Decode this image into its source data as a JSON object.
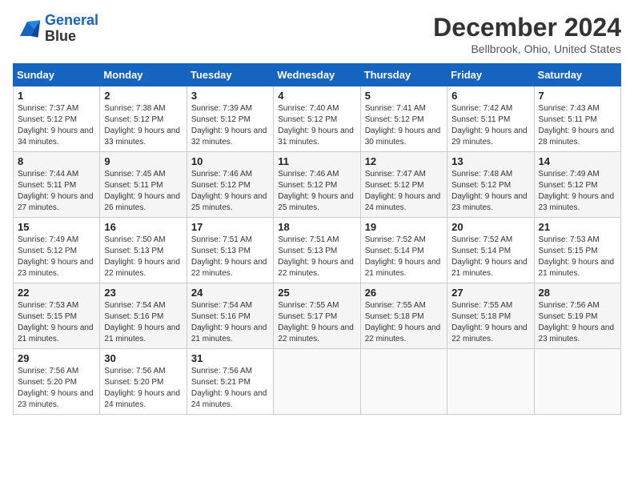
{
  "header": {
    "logo_line1": "General",
    "logo_line2": "Blue",
    "month_title": "December 2024",
    "location": "Bellbrook, Ohio, United States"
  },
  "days_of_week": [
    "Sunday",
    "Monday",
    "Tuesday",
    "Wednesday",
    "Thursday",
    "Friday",
    "Saturday"
  ],
  "weeks": [
    [
      {
        "day": "1",
        "sunrise": "Sunrise: 7:37 AM",
        "sunset": "Sunset: 5:12 PM",
        "daylight": "Daylight: 9 hours and 34 minutes."
      },
      {
        "day": "2",
        "sunrise": "Sunrise: 7:38 AM",
        "sunset": "Sunset: 5:12 PM",
        "daylight": "Daylight: 9 hours and 33 minutes."
      },
      {
        "day": "3",
        "sunrise": "Sunrise: 7:39 AM",
        "sunset": "Sunset: 5:12 PM",
        "daylight": "Daylight: 9 hours and 32 minutes."
      },
      {
        "day": "4",
        "sunrise": "Sunrise: 7:40 AM",
        "sunset": "Sunset: 5:12 PM",
        "daylight": "Daylight: 9 hours and 31 minutes."
      },
      {
        "day": "5",
        "sunrise": "Sunrise: 7:41 AM",
        "sunset": "Sunset: 5:12 PM",
        "daylight": "Daylight: 9 hours and 30 minutes."
      },
      {
        "day": "6",
        "sunrise": "Sunrise: 7:42 AM",
        "sunset": "Sunset: 5:11 PM",
        "daylight": "Daylight: 9 hours and 29 minutes."
      },
      {
        "day": "7",
        "sunrise": "Sunrise: 7:43 AM",
        "sunset": "Sunset: 5:11 PM",
        "daylight": "Daylight: 9 hours and 28 minutes."
      }
    ],
    [
      {
        "day": "8",
        "sunrise": "Sunrise: 7:44 AM",
        "sunset": "Sunset: 5:11 PM",
        "daylight": "Daylight: 9 hours and 27 minutes."
      },
      {
        "day": "9",
        "sunrise": "Sunrise: 7:45 AM",
        "sunset": "Sunset: 5:11 PM",
        "daylight": "Daylight: 9 hours and 26 minutes."
      },
      {
        "day": "10",
        "sunrise": "Sunrise: 7:46 AM",
        "sunset": "Sunset: 5:12 PM",
        "daylight": "Daylight: 9 hours and 25 minutes."
      },
      {
        "day": "11",
        "sunrise": "Sunrise: 7:46 AM",
        "sunset": "Sunset: 5:12 PM",
        "daylight": "Daylight: 9 hours and 25 minutes."
      },
      {
        "day": "12",
        "sunrise": "Sunrise: 7:47 AM",
        "sunset": "Sunset: 5:12 PM",
        "daylight": "Daylight: 9 hours and 24 minutes."
      },
      {
        "day": "13",
        "sunrise": "Sunrise: 7:48 AM",
        "sunset": "Sunset: 5:12 PM",
        "daylight": "Daylight: 9 hours and 23 minutes."
      },
      {
        "day": "14",
        "sunrise": "Sunrise: 7:49 AM",
        "sunset": "Sunset: 5:12 PM",
        "daylight": "Daylight: 9 hours and 23 minutes."
      }
    ],
    [
      {
        "day": "15",
        "sunrise": "Sunrise: 7:49 AM",
        "sunset": "Sunset: 5:12 PM",
        "daylight": "Daylight: 9 hours and 23 minutes."
      },
      {
        "day": "16",
        "sunrise": "Sunrise: 7:50 AM",
        "sunset": "Sunset: 5:13 PM",
        "daylight": "Daylight: 9 hours and 22 minutes."
      },
      {
        "day": "17",
        "sunrise": "Sunrise: 7:51 AM",
        "sunset": "Sunset: 5:13 PM",
        "daylight": "Daylight: 9 hours and 22 minutes."
      },
      {
        "day": "18",
        "sunrise": "Sunrise: 7:51 AM",
        "sunset": "Sunset: 5:13 PM",
        "daylight": "Daylight: 9 hours and 22 minutes."
      },
      {
        "day": "19",
        "sunrise": "Sunrise: 7:52 AM",
        "sunset": "Sunset: 5:14 PM",
        "daylight": "Daylight: 9 hours and 21 minutes."
      },
      {
        "day": "20",
        "sunrise": "Sunrise: 7:52 AM",
        "sunset": "Sunset: 5:14 PM",
        "daylight": "Daylight: 9 hours and 21 minutes."
      },
      {
        "day": "21",
        "sunrise": "Sunrise: 7:53 AM",
        "sunset": "Sunset: 5:15 PM",
        "daylight": "Daylight: 9 hours and 21 minutes."
      }
    ],
    [
      {
        "day": "22",
        "sunrise": "Sunrise: 7:53 AM",
        "sunset": "Sunset: 5:15 PM",
        "daylight": "Daylight: 9 hours and 21 minutes."
      },
      {
        "day": "23",
        "sunrise": "Sunrise: 7:54 AM",
        "sunset": "Sunset: 5:16 PM",
        "daylight": "Daylight: 9 hours and 21 minutes."
      },
      {
        "day": "24",
        "sunrise": "Sunrise: 7:54 AM",
        "sunset": "Sunset: 5:16 PM",
        "daylight": "Daylight: 9 hours and 21 minutes."
      },
      {
        "day": "25",
        "sunrise": "Sunrise: 7:55 AM",
        "sunset": "Sunset: 5:17 PM",
        "daylight": "Daylight: 9 hours and 22 minutes."
      },
      {
        "day": "26",
        "sunrise": "Sunrise: 7:55 AM",
        "sunset": "Sunset: 5:18 PM",
        "daylight": "Daylight: 9 hours and 22 minutes."
      },
      {
        "day": "27",
        "sunrise": "Sunrise: 7:55 AM",
        "sunset": "Sunset: 5:18 PM",
        "daylight": "Daylight: 9 hours and 22 minutes."
      },
      {
        "day": "28",
        "sunrise": "Sunrise: 7:56 AM",
        "sunset": "Sunset: 5:19 PM",
        "daylight": "Daylight: 9 hours and 23 minutes."
      }
    ],
    [
      {
        "day": "29",
        "sunrise": "Sunrise: 7:56 AM",
        "sunset": "Sunset: 5:20 PM",
        "daylight": "Daylight: 9 hours and 23 minutes."
      },
      {
        "day": "30",
        "sunrise": "Sunrise: 7:56 AM",
        "sunset": "Sunset: 5:20 PM",
        "daylight": "Daylight: 9 hours and 24 minutes."
      },
      {
        "day": "31",
        "sunrise": "Sunrise: 7:56 AM",
        "sunset": "Sunset: 5:21 PM",
        "daylight": "Daylight: 9 hours and 24 minutes."
      },
      null,
      null,
      null,
      null
    ]
  ]
}
